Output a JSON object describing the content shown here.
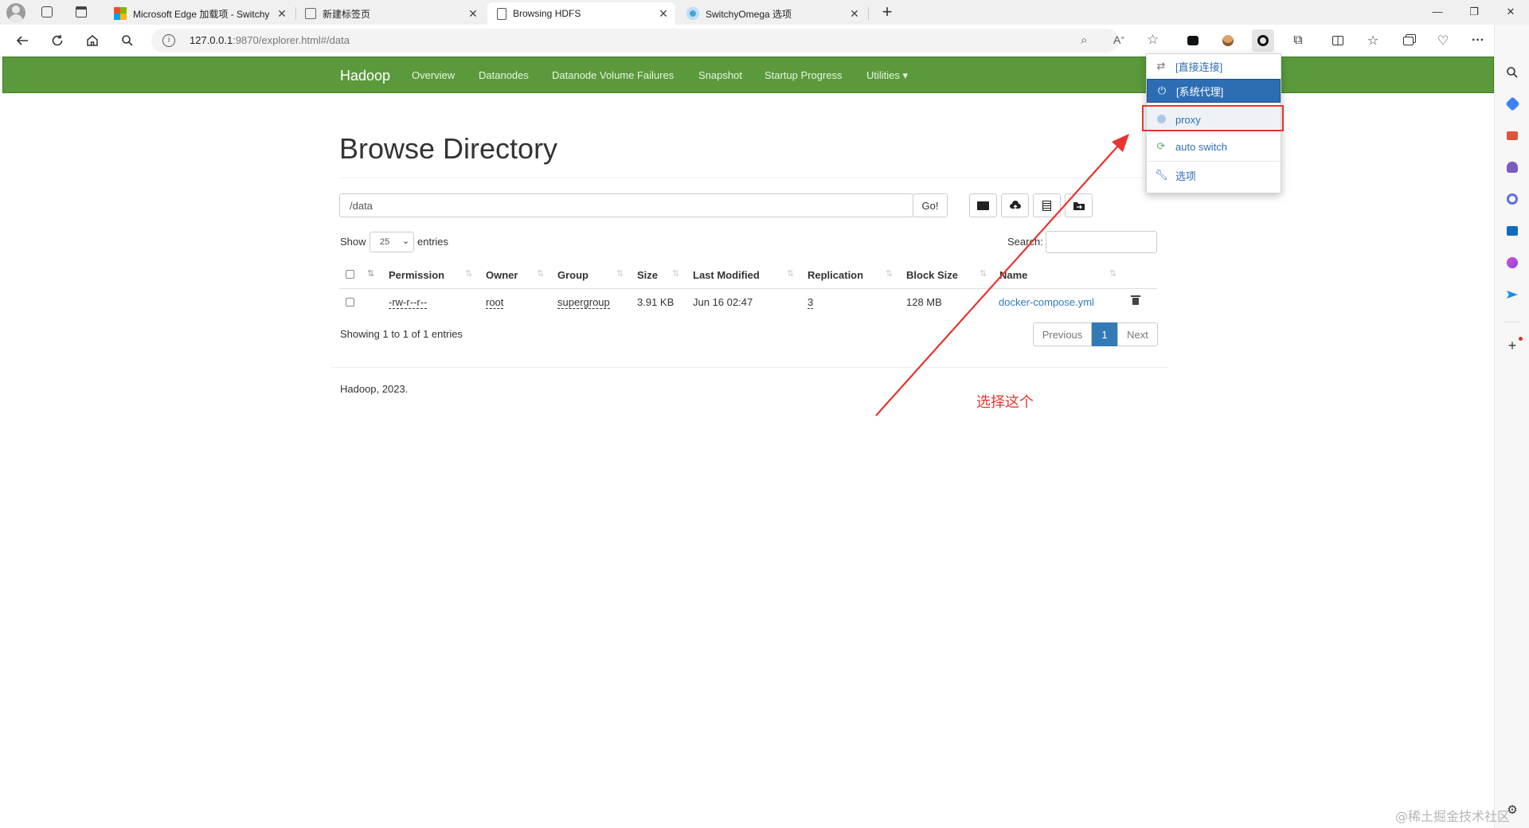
{
  "browser": {
    "tabs": [
      {
        "label": "Microsoft Edge 加载项 - Switchy",
        "close": "✕"
      },
      {
        "label": "新建标签页",
        "close": "✕"
      },
      {
        "label": "Browsing HDFS",
        "close": "✕"
      },
      {
        "label": "SwitchyOmega 选项",
        "close": "✕"
      }
    ],
    "new_tab": "+",
    "window_controls": {
      "minimize": "—",
      "restore": "❐",
      "close": "✕"
    },
    "address": {
      "host": "127.0.0.1",
      "rest": ":9870/explorer.html#/data"
    },
    "sidebar_add": "+"
  },
  "hadoop_nav": {
    "brand": "Hadoop",
    "links": [
      "Overview",
      "Datanodes",
      "Datanode Volume Failures",
      "Snapshot",
      "Startup Progress",
      "Utilities ▾"
    ]
  },
  "explorer": {
    "title": "Browse Directory",
    "path_value": "/data",
    "go_label": "Go!",
    "show_label": "Show",
    "entries_value": "25",
    "entries_label": "entries",
    "search_label": "Search:",
    "columns": [
      "Permission",
      "Owner",
      "Group",
      "Size",
      "Last Modified",
      "Replication",
      "Block Size",
      "Name"
    ],
    "rows": [
      {
        "permission": "-rw-r--r--",
        "owner": "root",
        "group": "supergroup",
        "size": "3.91 KB",
        "last_modified": "Jun 16 02:47",
        "replication": "3",
        "block_size": "128 MB",
        "name": "docker-compose.yml"
      }
    ],
    "showing_text": "Showing 1 to 1 of 1 entries",
    "pagination": {
      "previous": "Previous",
      "current": "1",
      "next": "Next"
    },
    "footer": "Hadoop, 2023."
  },
  "proxy_popup": {
    "items": [
      {
        "label": "[直接连接]",
        "icon": "arrows-swap-icon"
      },
      {
        "label": "[系统代理]",
        "icon": "power-icon",
        "selected": true
      },
      {
        "label": "proxy",
        "icon": "globe-icon",
        "highlighted": true
      },
      {
        "label": "auto switch",
        "icon": "auto-switch-icon"
      },
      {
        "label": "选项",
        "icon": "wrench-icon"
      }
    ]
  },
  "annotation": {
    "text": "选择这个",
    "color": "#e8342f"
  },
  "watermark": "@稀土掘金技术社区",
  "colors": {
    "nav_green": "#5a9a3c",
    "link_blue": "#337ab7",
    "selected_blue": "#2d6db3",
    "annotation_red": "#e8342f"
  }
}
